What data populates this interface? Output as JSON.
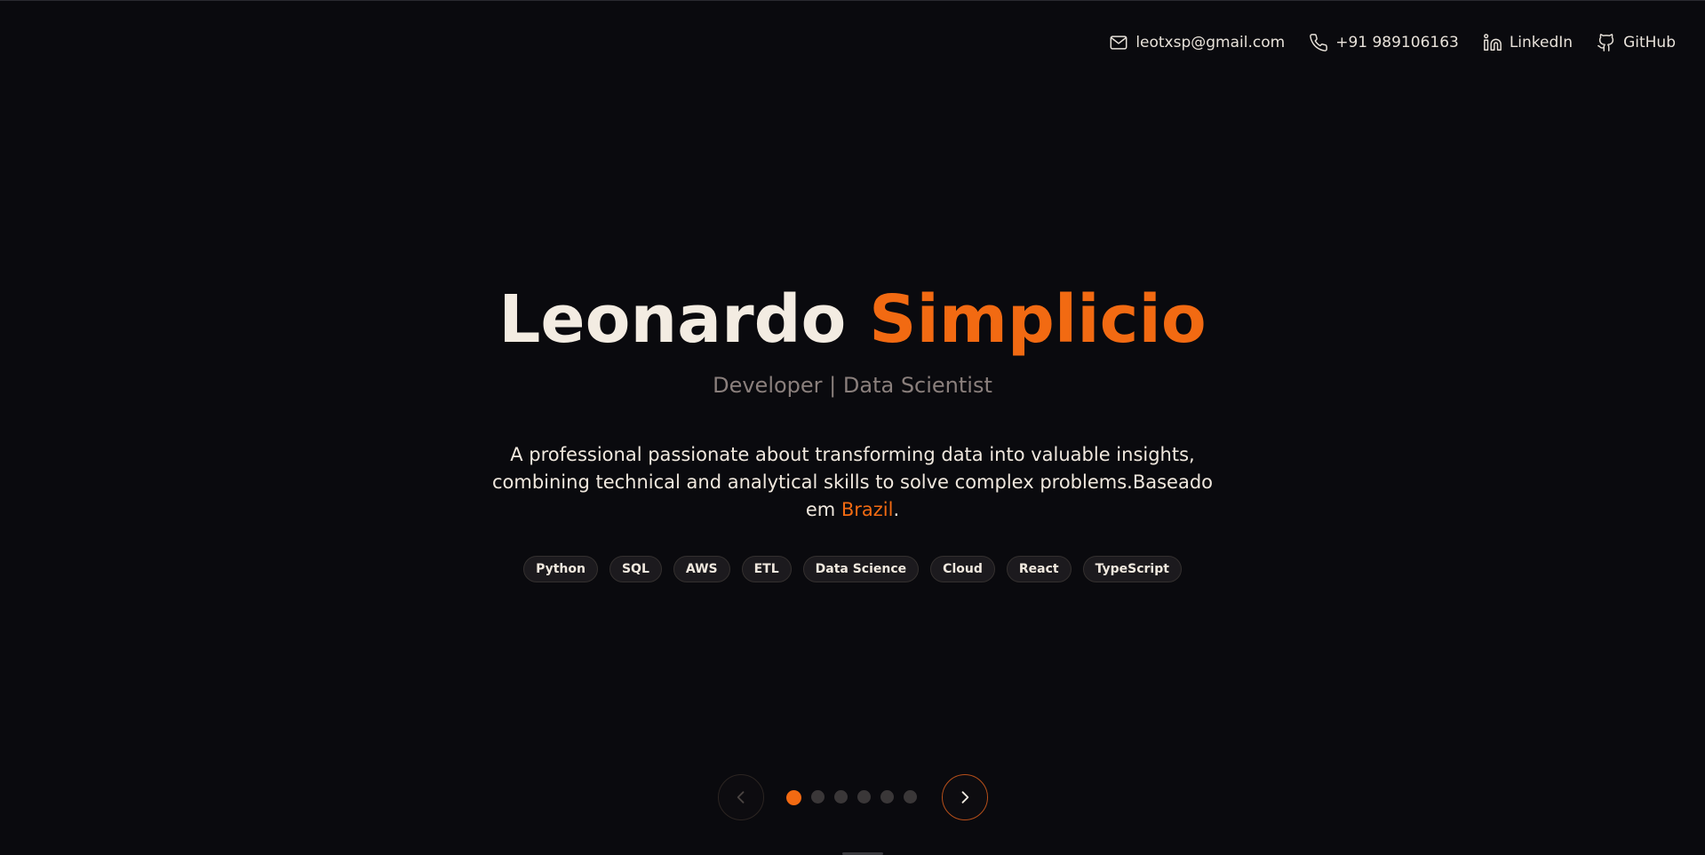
{
  "header": {
    "email": "leotxsp@gmail.com",
    "phone": "+91 989106163",
    "linkedin": "LinkedIn",
    "github": "GitHub"
  },
  "hero": {
    "first_name": "Leonardo",
    "last_name": "Simplicio",
    "role": "Developer | Data Scientist",
    "description": "A professional passionate about transforming data into valuable insights, combining technical and analytical skills to solve complex problems.Baseado em ",
    "location": "Brazil",
    "period": "."
  },
  "skills": [
    "Python",
    "SQL",
    "AWS",
    "ETL",
    "Data Science",
    "Cloud",
    "React",
    "TypeScript"
  ],
  "carousel": {
    "total_slides": 6,
    "active_slide": 1
  },
  "colors": {
    "background": "#0a0a0e",
    "accent": "#f26a12",
    "text": "#f3ece2",
    "muted": "#8a7f7c"
  },
  "icons": {
    "email": "mail-icon",
    "phone": "phone-icon",
    "linkedin": "linkedin-icon",
    "github": "github-icon",
    "prev": "chevron-left-icon",
    "next": "chevron-right-icon"
  }
}
